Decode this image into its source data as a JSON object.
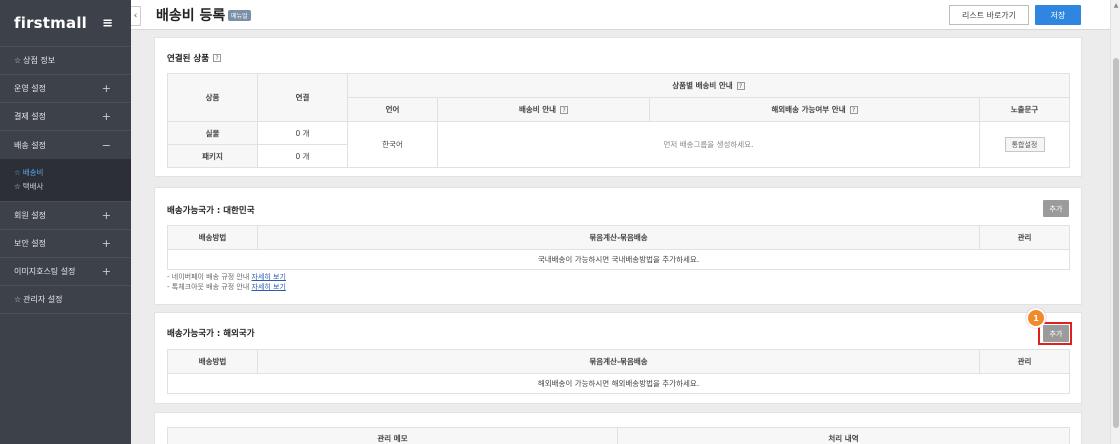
{
  "sidebar": {
    "logo": "firstmall",
    "menu_icon": "hamburger-icon",
    "items": [
      {
        "label": "상점 정보",
        "star": true,
        "sign": ""
      },
      {
        "label": "운영 설정",
        "star": false,
        "sign": "+"
      },
      {
        "label": "결제 설정",
        "star": false,
        "sign": "+"
      },
      {
        "label": "배송 설정",
        "star": false,
        "sign": "−"
      }
    ],
    "submenu": [
      {
        "label": "배송비",
        "active": true
      },
      {
        "label": "택배사",
        "active": false
      }
    ],
    "items_after": [
      {
        "label": "회원 설정",
        "star": false,
        "sign": "+"
      },
      {
        "label": "보안 설정",
        "star": false,
        "sign": "+"
      },
      {
        "label": "이미지호스팅 설정",
        "star": false,
        "sign": "+"
      },
      {
        "label": "관리자 설정",
        "star": true,
        "sign": ""
      }
    ]
  },
  "header": {
    "collapse_icon": "‹",
    "title": "배송비 등록",
    "badge": "메뉴얼",
    "list_button": "리스트 바로가기",
    "save_button": "저장"
  },
  "linked": {
    "title": "연결된 상품",
    "help": "?",
    "col_product": "상품",
    "col_link": "연결",
    "col_guide": "상품별 배송비 안내",
    "col_lang": "언어",
    "col_fee_guide": "배송비 안내",
    "col_overseas_guide": "해외배송 가능여부 안내",
    "col_exposure": "노출문구",
    "rows": [
      {
        "product": "실물",
        "count": "0 개"
      },
      {
        "product": "패키지",
        "count": "0 개"
      }
    ],
    "language": "한국어",
    "empty_message": "먼저 배송그룹을 생성하세요.",
    "unified_button": "통합설정"
  },
  "domestic": {
    "title": "배송가능국가 : 대한민국",
    "add_button": "추가",
    "col_method": "배송방법",
    "col_bundle": "묶음계산-묶음배송",
    "col_manage": "관리",
    "empty_message": "국내배송이 가능하시면 국내배송방법을 추가하세요.",
    "guides": [
      {
        "text": "- 네이버페이 배송 규정 안내",
        "link": "자세히 보기"
      },
      {
        "text": "- 톡체크아웃 배송 규정 안내",
        "link": "자세히 보기"
      }
    ]
  },
  "overseas": {
    "title": "배송가능국가 : 해외국가",
    "add_button": "추가",
    "col_method": "배송방법",
    "col_bundle": "묶음계산-묶음배송",
    "col_manage": "관리",
    "empty_message": "해외배송이 가능하시면 해외배송방법을 추가하세요.",
    "step_number": "1"
  },
  "memo": {
    "col_memo": "관리 메모",
    "col_history": "처리 내역"
  },
  "colors": {
    "sidebar_bg": "#3d414a",
    "accent_blue": "#2f86e0",
    "step_orange": "#f08a2c",
    "highlight_red": "#e02020"
  }
}
